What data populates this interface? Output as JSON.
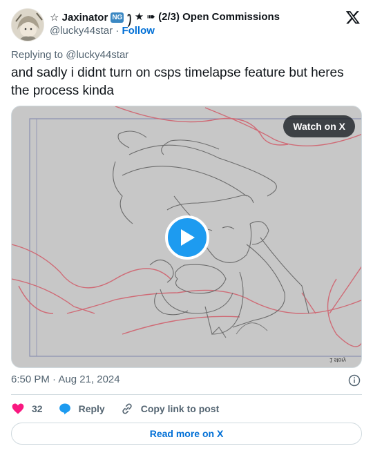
{
  "header": {
    "display_name_prefix": "☆ Jaxinator",
    "ng_badge": "NG",
    "display_name_suffix": "ꫂ ★ ➠ (2/3) Open Commissions",
    "handle": "@lucky44star",
    "separator": "·",
    "follow_label": "Follow"
  },
  "tweet": {
    "replying_to": "Replying to @lucky44star",
    "text": "and sadly i didnt turn on csps timelapse feature but heres the process kinda",
    "timestamp": "6:50 PM · Aug 21, 2024"
  },
  "media": {
    "watch_label": "Watch on X",
    "signature": "1 story"
  },
  "actions": {
    "like_count": "32",
    "reply_label": "Reply",
    "copy_label": "Copy link to post"
  },
  "footer": {
    "read_more_label": "Read more on X"
  },
  "colors": {
    "accent": "#1d9bf0",
    "link": "#006fd6",
    "heart": "#f91880",
    "muted": "#536471"
  }
}
